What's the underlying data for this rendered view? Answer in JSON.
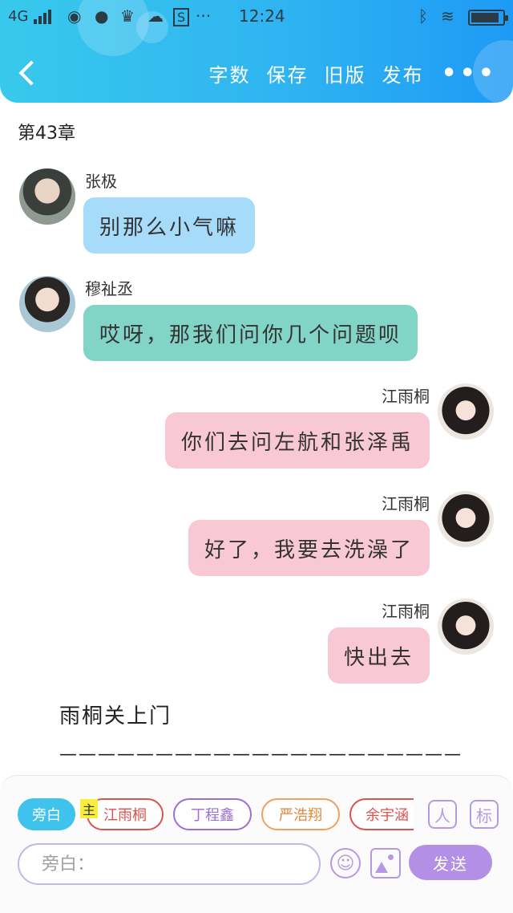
{
  "statusbar": {
    "network": "4G",
    "time": "12:24",
    "left_icons": [
      "weibo-icon",
      "planet-icon",
      "crown-icon",
      "cloud-icon",
      "s-badge-icon",
      "more-notifications-icon"
    ],
    "right_icons": [
      "bluetooth-icon",
      "wifi-icon",
      "battery-icon"
    ]
  },
  "header": {
    "actions": [
      "字数",
      "保存",
      "旧版",
      "发布"
    ],
    "more_label": "•••",
    "gradient_colors": [
      "#38c9ec",
      "#1e9af5"
    ]
  },
  "chapter_title": "第43章",
  "messages": [
    {
      "side": "left",
      "name": "张极",
      "text": "别那么小气嘛",
      "color": "#a6dbfa"
    },
    {
      "side": "left",
      "name": "穆祉丞",
      "text": "哎呀，那我们问你几个问题呗",
      "color": "#82d4c6"
    },
    {
      "side": "right",
      "name": "江雨桐",
      "text": "你们去问左航和张泽禹",
      "color": "#f8c8d4"
    },
    {
      "side": "right",
      "name": "江雨桐",
      "text": "好了，我要去洗澡了",
      "color": "#f8c8d4"
    },
    {
      "side": "right",
      "name": "江雨桐",
      "text": "快出去",
      "color": "#f8c8d4"
    }
  ],
  "narration": "雨桐关上门",
  "divider": "——————————————————————",
  "composer": {
    "main_tag": "主",
    "chips": [
      {
        "label": "旁白",
        "active": true,
        "color": "#3fc2ec"
      },
      {
        "label": "江雨桐",
        "active": false,
        "color": "#d9534f"
      },
      {
        "label": "丁程鑫",
        "active": false,
        "color": "#9b6fd6"
      },
      {
        "label": "严浩翔",
        "active": false,
        "color": "#f0a060"
      },
      {
        "label": "余宇涵",
        "active": false,
        "color": "#d9534f"
      }
    ],
    "tool_buttons": {
      "role": "人",
      "mark": "标"
    },
    "input_placeholder": "旁白：",
    "send_label": "发送",
    "accent": "#b48fe6"
  }
}
